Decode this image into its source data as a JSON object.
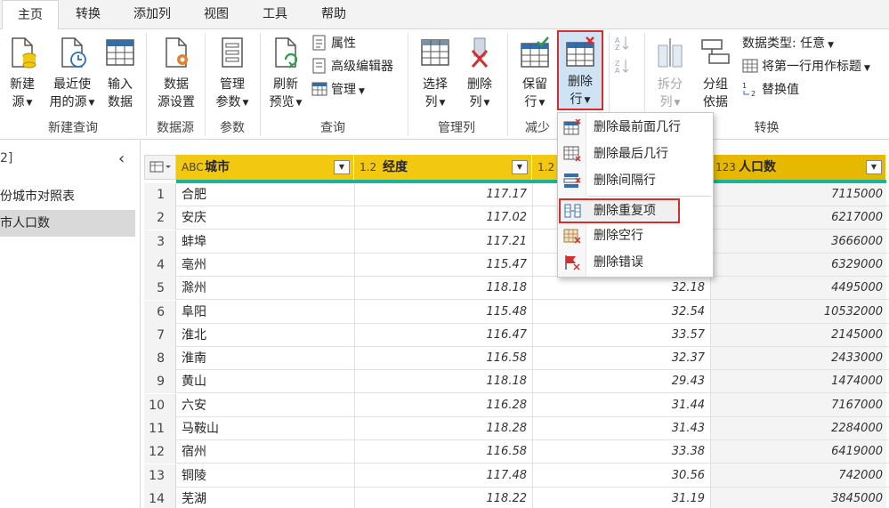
{
  "tabs": [
    {
      "label": "主页",
      "active": true
    },
    {
      "label": "转换",
      "active": false
    },
    {
      "label": "添加列",
      "active": false
    },
    {
      "label": "视图",
      "active": false
    },
    {
      "label": "工具",
      "active": false
    },
    {
      "label": "帮助",
      "active": false
    }
  ],
  "ribbon": {
    "new_source": {
      "l1": "新建",
      "l2": "源"
    },
    "recent_sources": {
      "l1": "最近使",
      "l2": "用的源"
    },
    "enter_data": {
      "l1": "输入",
      "l2": "数据"
    },
    "data_source_settings": {
      "l1": "数据",
      "l2": "源设置"
    },
    "manage_parameters": {
      "l1": "管理",
      "l2": "参数"
    },
    "refresh_preview": {
      "l1": "刷新",
      "l2": "预览"
    },
    "properties": "属性",
    "advanced_editor": "高级编辑器",
    "manage": "管理",
    "choose_columns": {
      "l1": "选择",
      "l2": "列"
    },
    "remove_columns": {
      "l1": "删除",
      "l2": "列"
    },
    "keep_rows": {
      "l1": "保留",
      "l2": "行"
    },
    "remove_rows": {
      "l1": "删除",
      "l2": "行"
    },
    "split_column": {
      "l1": "拆分",
      "l2": "列"
    },
    "group_by": {
      "l1": "分组",
      "l2": "依据"
    },
    "data_type": "数据类型: 任意",
    "use_first_row": "将第一行用作标题",
    "replace_values": "替换值",
    "groups": {
      "new_query": "新建查询",
      "data_sources": "数据源",
      "parameters": "参数",
      "query": "查询",
      "manage_columns": "管理列",
      "reduce_rows_partial": "减少",
      "transform": "转换"
    }
  },
  "left_pane": {
    "count": "2]",
    "items": [
      "份城市对照表",
      "市人口数"
    ]
  },
  "grid": {
    "headers": [
      {
        "type": "ABC",
        "name": "城市"
      },
      {
        "type": "1.2",
        "name": "经度"
      },
      {
        "type": "1.2",
        "name": ""
      },
      {
        "type": "123",
        "name": "人口数"
      }
    ],
    "rows": [
      {
        "n": "1",
        "city": "合肥",
        "lng": "117.17",
        "lat": "",
        "pop": "7115000"
      },
      {
        "n": "2",
        "city": "安庆",
        "lng": "117.02",
        "lat": "",
        "pop": "6217000"
      },
      {
        "n": "3",
        "city": "蚌埠",
        "lng": "117.21",
        "lat": "",
        "pop": "3666000"
      },
      {
        "n": "4",
        "city": "亳州",
        "lng": "115.47",
        "lat": "",
        "pop": "6329000"
      },
      {
        "n": "5",
        "city": "滁州",
        "lng": "118.18",
        "lat": "32.18",
        "pop": "4495000"
      },
      {
        "n": "6",
        "city": "阜阳",
        "lng": "115.48",
        "lat": "32.54",
        "pop": "10532000"
      },
      {
        "n": "7",
        "city": "淮北",
        "lng": "116.47",
        "lat": "33.57",
        "pop": "2145000"
      },
      {
        "n": "8",
        "city": "淮南",
        "lng": "116.58",
        "lat": "32.37",
        "pop": "2433000"
      },
      {
        "n": "9",
        "city": "黄山",
        "lng": "118.18",
        "lat": "29.43",
        "pop": "1474000"
      },
      {
        "n": "10",
        "city": "六安",
        "lng": "116.28",
        "lat": "31.44",
        "pop": "7167000"
      },
      {
        "n": "11",
        "city": "马鞍山",
        "lng": "118.28",
        "lat": "31.43",
        "pop": "2284000"
      },
      {
        "n": "12",
        "city": "宿州",
        "lng": "116.58",
        "lat": "33.38",
        "pop": "6419000"
      },
      {
        "n": "13",
        "city": "铜陵",
        "lng": "117.48",
        "lat": "30.56",
        "pop": "742000"
      },
      {
        "n": "14",
        "city": "芜湖",
        "lng": "118.22",
        "lat": "31.19",
        "pop": "3845000"
      }
    ]
  },
  "menu": {
    "items": [
      {
        "label": "删除最前面几行",
        "icon": "remove-top-rows-icon"
      },
      {
        "label": "删除最后几行",
        "icon": "remove-bottom-rows-icon"
      },
      {
        "label": "删除间隔行",
        "icon": "remove-alternate-rows-icon"
      },
      {
        "label": "删除重复项",
        "icon": "remove-duplicates-icon"
      },
      {
        "label": "删除空行",
        "icon": "remove-blank-rows-icon"
      },
      {
        "label": "删除错误",
        "icon": "remove-errors-icon"
      }
    ]
  },
  "colors": {
    "header_yellow": "#f2c811",
    "accent_teal": "#1ab39b",
    "highlight_red": "#d32f2f",
    "ribbon_blue": "#2f6fb0"
  }
}
